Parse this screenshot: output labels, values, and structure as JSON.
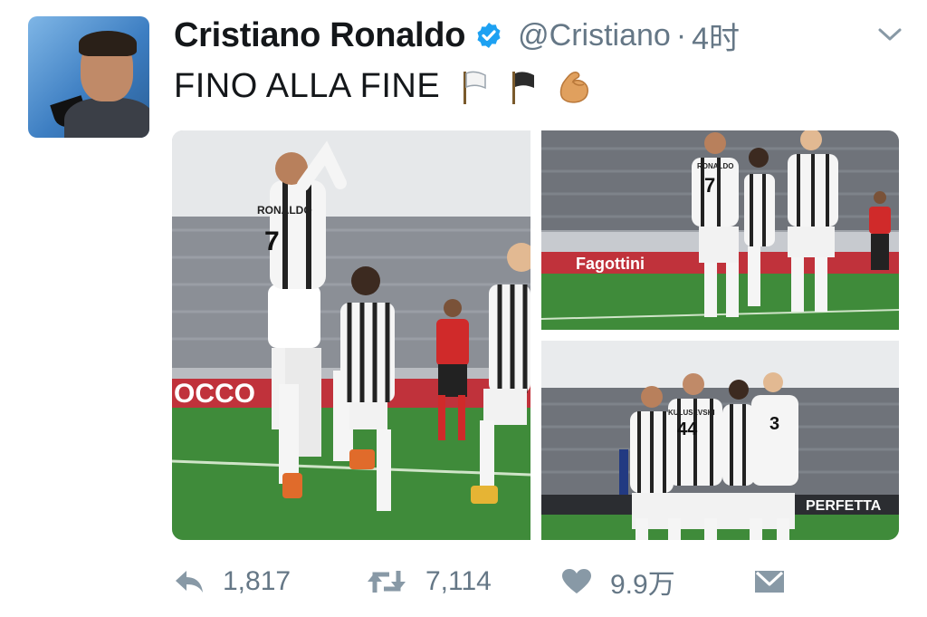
{
  "author": {
    "name": "Cristiano Ronaldo",
    "handle": "@Cristiano",
    "separator": "·",
    "time": "4时",
    "verified": true
  },
  "tweet": {
    "text": "FINO ALLA FINE"
  },
  "media": {
    "photos": [
      {
        "shirt_text": "RONALDO",
        "number": "7",
        "board": "OCCO"
      },
      {
        "shirt_text": "RONALDO",
        "number": "7",
        "board": "Fagottini"
      },
      {
        "shirt_text": "KULUSEVSKI",
        "number": "44",
        "board": "PERFETTA"
      }
    ]
  },
  "actions": {
    "reply_count": "1,817",
    "retweet_count": "7,114",
    "like_count": "9.9万"
  },
  "colors": {
    "text": "#14171a",
    "secondary": "#657786",
    "verified": "#1da1f2",
    "pitch": "#3f8b3a",
    "stand": "#8a8d93"
  },
  "icons": {
    "verified": "verified-badge-icon",
    "caret": "chevron-down-icon",
    "reply": "reply-icon",
    "retweet": "retweet-icon",
    "like": "heart-icon",
    "share": "share-icon"
  }
}
